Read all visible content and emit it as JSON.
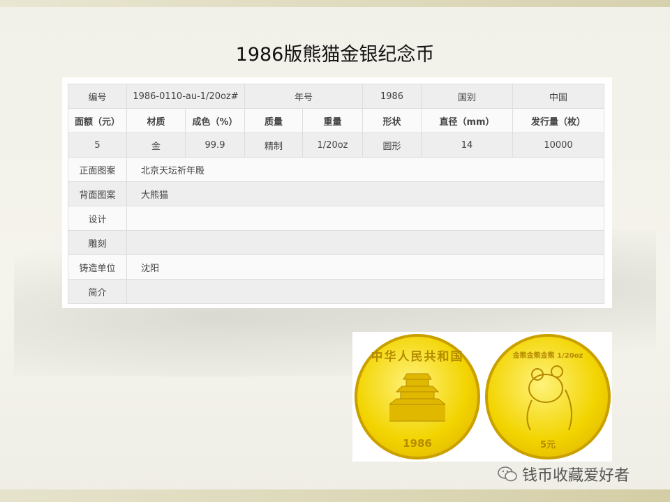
{
  "title": "1986版熊猫金银纪念币",
  "table": {
    "row1": [
      "编号",
      "1986-0110-au-1/20oz#",
      "年号",
      "1986",
      "国别",
      "中国"
    ],
    "headers": [
      "面额（元）",
      "材质",
      "成色（%）",
      "质量",
      "重量",
      "形状",
      "直径（mm）",
      "发行量（枚）"
    ],
    "values": [
      "5",
      "金",
      "99.9",
      "精制",
      "1/20oz",
      "圆形",
      "14",
      "10000"
    ],
    "details": [
      {
        "label": "正面图案",
        "value": "北京天坛祈年殿"
      },
      {
        "label": "背面图案",
        "value": "大熊猫"
      },
      {
        "label": "设计",
        "value": ""
      },
      {
        "label": "雕刻",
        "value": ""
      },
      {
        "label": "铸造单位",
        "value": "沈阳"
      },
      {
        "label": "简介",
        "value": ""
      }
    ]
  },
  "coins": {
    "obverse": {
      "legend": "中华人民共和国",
      "year": "1986"
    },
    "reverse": {
      "legend": "金熊金熊金熊 1/20oz",
      "denomination": "5元"
    }
  },
  "watermark": {
    "icon": "wechat-icon",
    "text": "钱币收藏爱好者"
  },
  "colors": {
    "gold": "#f2d400",
    "table_gray": "#eeeeee"
  }
}
